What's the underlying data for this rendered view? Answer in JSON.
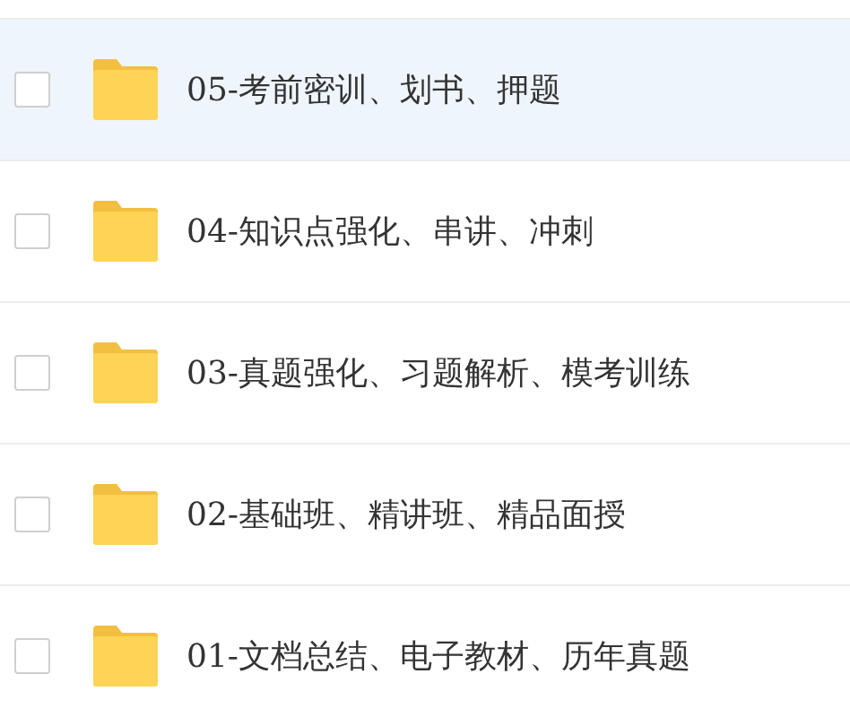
{
  "files": [
    {
      "name": "05-考前密训、划书、押题",
      "highlighted": true,
      "checked": false
    },
    {
      "name": "04-知识点强化、串讲、冲刺",
      "highlighted": false,
      "checked": false
    },
    {
      "name": "03-真题强化、习题解析、模考训练",
      "highlighted": false,
      "checked": false
    },
    {
      "name": "02-基础班、精讲班、精品面授",
      "highlighted": false,
      "checked": false
    },
    {
      "name": "01-文档总结、电子教材、历年真题",
      "highlighted": false,
      "checked": false
    }
  ]
}
